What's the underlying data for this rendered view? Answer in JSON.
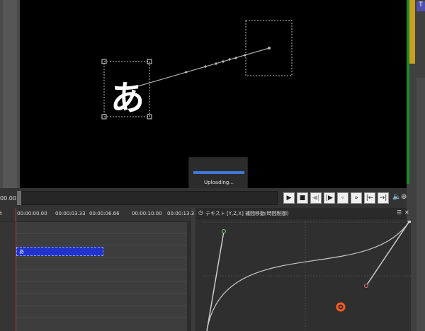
{
  "seek": {
    "time": "00.00"
  },
  "upload": {
    "status": "Uploading..."
  },
  "timeline": {
    "left_label": "t",
    "ruler": [
      "00:00:00.00",
      "00:00:03.33",
      "00:00:06.66",
      "00:00:10.00",
      "00:00:13.3"
    ],
    "clip_label": "あ"
  },
  "graph": {
    "title": "テキスト [Y,Z,X] 補間移動(時間制御)"
  },
  "icons": {
    "play": "play-icon",
    "stop": "stop-icon",
    "prev_frame": "prev-frame-icon",
    "next_frame": "next-frame-icon",
    "rewind": "rewind-icon",
    "fast_forward": "fast-forward-icon",
    "go_start": "go-to-start-icon",
    "go_end": "go-to-end-icon",
    "volume": "volume-icon",
    "zoom": "zoom-icon"
  },
  "colors": {
    "accent": "#3f78d8",
    "clip": "#2233cc",
    "cursor": "#d04040",
    "target": "#ff5a1f"
  }
}
